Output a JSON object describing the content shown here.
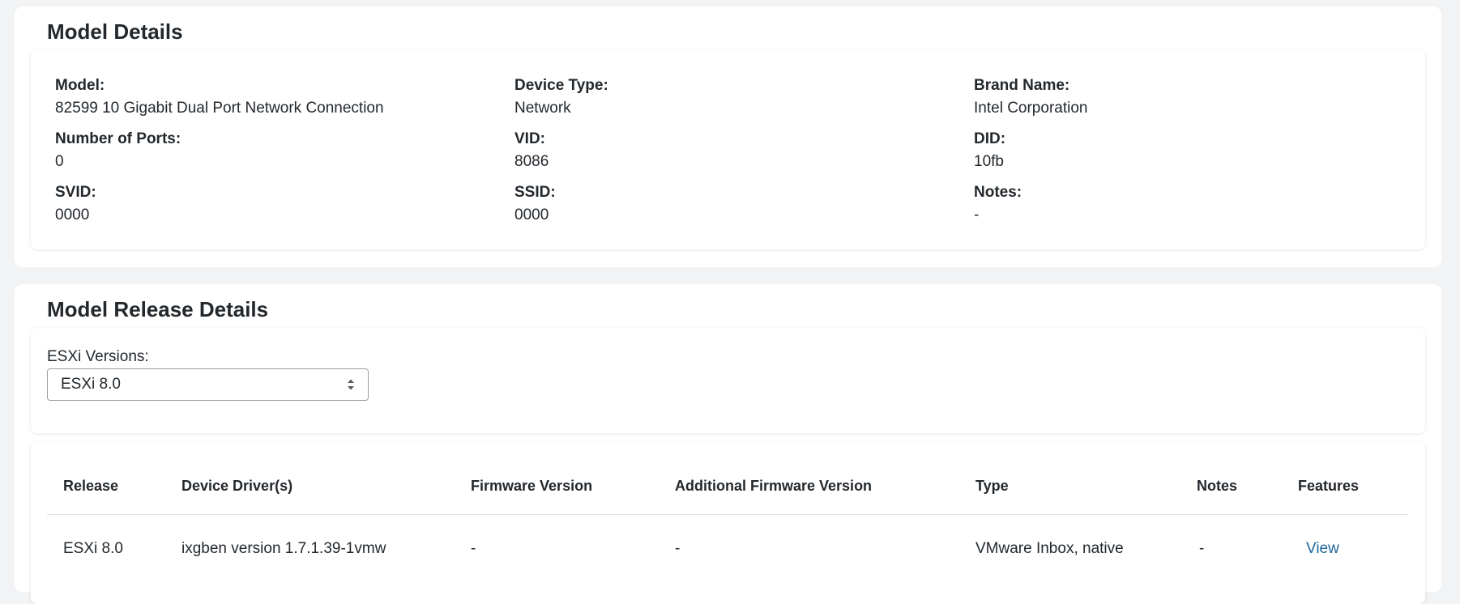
{
  "model_details": {
    "title": "Model Details",
    "fields": [
      {
        "label": "Model:",
        "value": "82599 10 Gigabit Dual Port Network Connection"
      },
      {
        "label": "Device Type:",
        "value": "Network"
      },
      {
        "label": "Brand Name:",
        "value": "Intel Corporation"
      },
      {
        "label": "Number of Ports:",
        "value": "0"
      },
      {
        "label": "VID:",
        "value": "8086"
      },
      {
        "label": "DID:",
        "value": "10fb"
      },
      {
        "label": "SVID:",
        "value": "0000"
      },
      {
        "label": "SSID:",
        "value": "0000"
      },
      {
        "label": "Notes:",
        "value": "-"
      }
    ]
  },
  "release_details": {
    "title": "Model Release Details",
    "esxi_select": {
      "label": "ESXi Versions:",
      "selected": "ESXi 8.0"
    },
    "table": {
      "headers": [
        "Release",
        "Device Driver(s)",
        "Firmware Version",
        "Additional Firmware Version",
        "Type",
        "Notes",
        "Features"
      ],
      "rows": [
        [
          "ESXi 8.0",
          "ixgben version 1.7.1.39-1vmw",
          "-",
          "-",
          "VMware Inbox, native",
          "-",
          "View"
        ]
      ]
    }
  },
  "colors": {
    "link": "#1f6799",
    "page_bg": "#f2f3f5"
  }
}
